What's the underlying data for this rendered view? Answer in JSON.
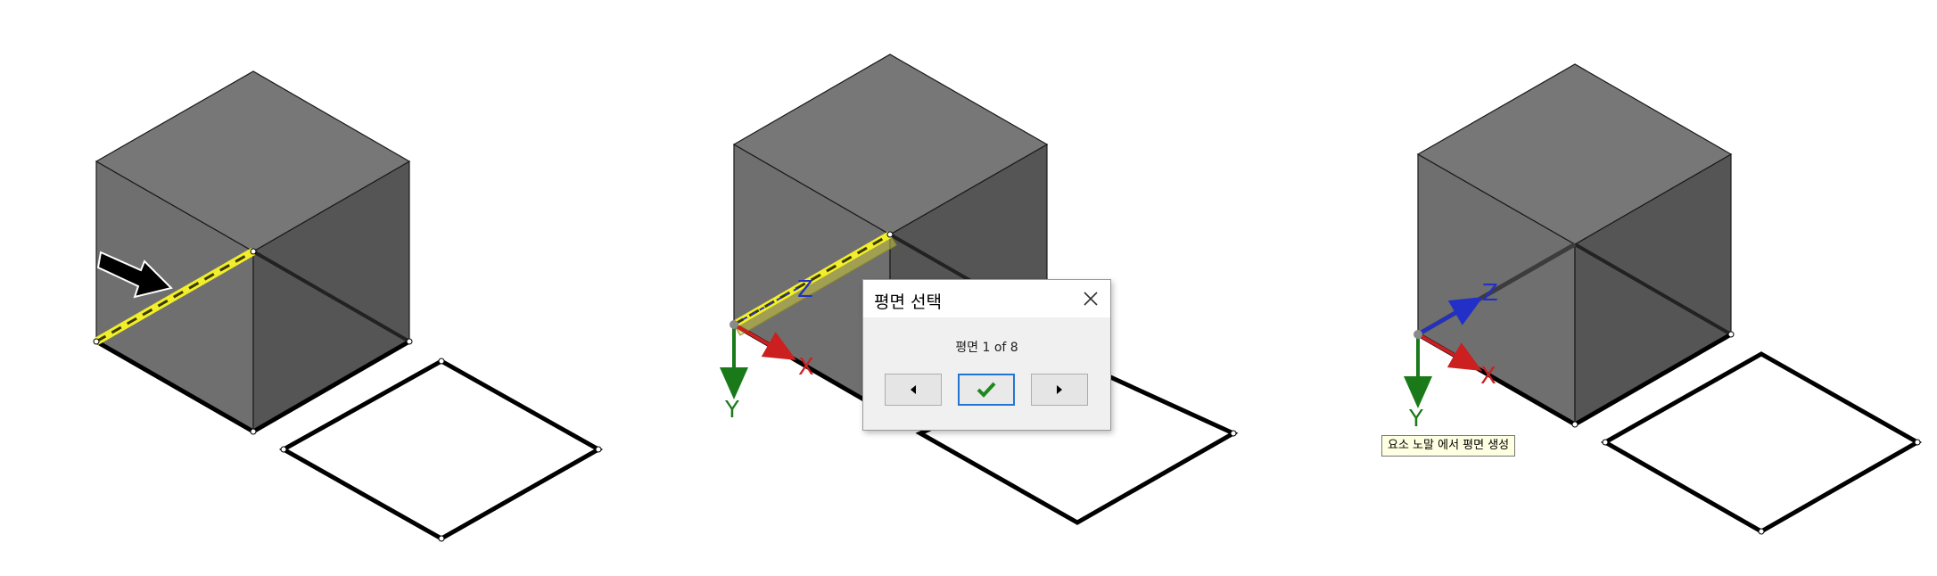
{
  "panels": [
    {
      "name": "panel-1-select-edge"
    },
    {
      "name": "panel-2-plane-selection",
      "axes": {
        "x": "X",
        "y": "Y",
        "z": "Z"
      }
    },
    {
      "name": "panel-3-plane-created",
      "axes": {
        "x": "X",
        "y": "Y",
        "z": "Z"
      },
      "tooltip": "요소 노말 에서 평면 생성"
    }
  ],
  "dialog": {
    "title": "평면 선택",
    "counter": "평면 1 of 8",
    "buttons": {
      "prev_icon": "triangle-left-icon",
      "ok_icon": "green-checkmark-icon",
      "next_icon": "triangle-right-icon",
      "close_icon": "close-x-icon"
    }
  },
  "colors": {
    "cube_left": "#6f6f6f",
    "cube_right": "#555555",
    "cube_top": "#777777",
    "highlight_edge": "#f2ef2a",
    "axis_x": "#cc1f1f",
    "axis_y": "#1a7a1a",
    "axis_z": "#2230c8",
    "ok_border": "#2474d6"
  }
}
